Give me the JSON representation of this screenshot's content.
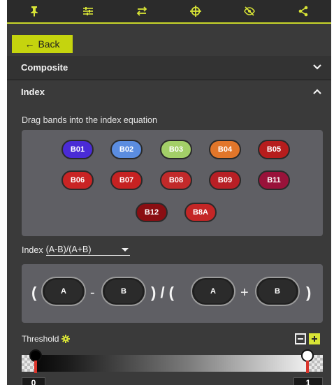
{
  "toolbar": {
    "icons": [
      "pin-icon",
      "sliders-icon",
      "swap-icon",
      "crosshair-icon",
      "eye-off-icon",
      "share-icon"
    ],
    "accent_color": "#d8e436"
  },
  "back_button": {
    "label": "Back",
    "color": "#c5d40e"
  },
  "sections": {
    "composite": {
      "label": "Composite",
      "expanded": false
    },
    "index": {
      "label": "Index",
      "expanded": true
    }
  },
  "index_panel": {
    "hint": "Drag bands into the index equation",
    "bands": [
      {
        "label": "B01",
        "color": "#4a2bd6"
      },
      {
        "label": "B02",
        "color": "#5b8de0"
      },
      {
        "label": "B03",
        "color": "#a3cf68"
      },
      {
        "label": "B04",
        "color": "#e1762a"
      },
      {
        "label": "B05",
        "color": "#b61d1d"
      },
      {
        "label": "B06",
        "color": "#c92424"
      },
      {
        "label": "B07",
        "color": "#c62222"
      },
      {
        "label": "B08",
        "color": "#c22a2a"
      },
      {
        "label": "B09",
        "color": "#b81f25"
      },
      {
        "label": "B11",
        "color": "#99123a"
      },
      {
        "label": "B12",
        "color": "#8a0e12"
      },
      {
        "label": "B8A",
        "color": "#c42626"
      }
    ],
    "index_label": "Index",
    "formula": "(A-B)/(A+B)",
    "equation": {
      "open_paren": "(",
      "close_paren": ")",
      "slot_a1": "A",
      "op_minus": "-",
      "slot_b1": "B",
      "divide": ") / (",
      "slot_a2": "A",
      "op_plus": "+",
      "slot_b2": "B"
    }
  },
  "threshold": {
    "label": "Threshold",
    "min_value": "0",
    "max_value": "1"
  }
}
